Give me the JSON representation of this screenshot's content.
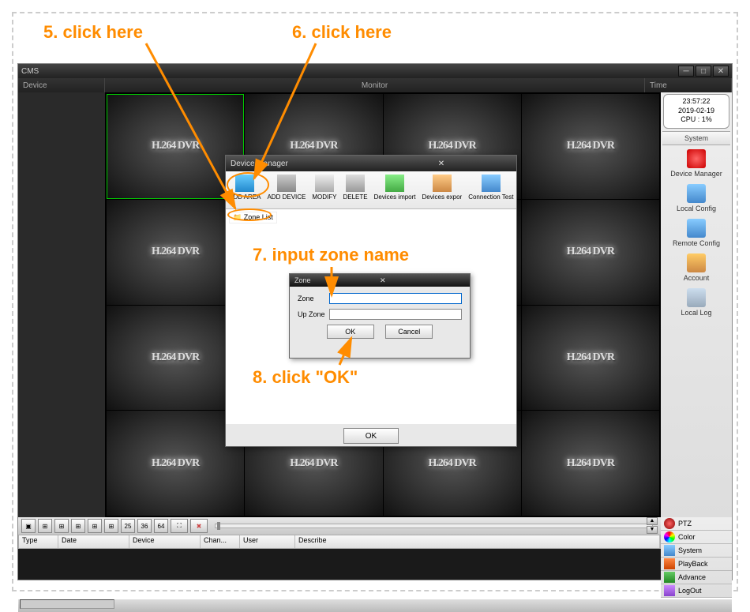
{
  "annotations": {
    "a5": "5. click here",
    "a6": "6. click here",
    "a7": "7. input zone name",
    "a8": "8. click \"OK\""
  },
  "app": {
    "title": "CMS",
    "header": {
      "device": "Device",
      "monitor": "Monitor",
      "time": "Time"
    },
    "clock": {
      "time": "23:57:22",
      "date": "2019-02-19",
      "cpu": "CPU : 1%"
    },
    "system_header": "System",
    "sys_items": [
      "Device Manager",
      "Local Config",
      "Remote Config",
      "Account",
      "Local Log"
    ],
    "cell_text": "H.264 DVR",
    "toolbar_nums": [
      "25",
      "36",
      "64"
    ],
    "log_cols": [
      "Type",
      "Date",
      "Device",
      "Chan...",
      "User",
      "Describe"
    ],
    "right_btns": [
      "PTZ",
      "Color",
      "System",
      "PlayBack",
      "Advance",
      "LogOut"
    ]
  },
  "dlg": {
    "title": "Device Manager",
    "btns": [
      "ADD AREA",
      "ADD DEVICE",
      "MODIFY",
      "DELETE",
      "Devices import",
      "Devices expor",
      "Connection Test"
    ],
    "zone_list": "Zone List",
    "ok": "OK"
  },
  "zone": {
    "title": "Zone",
    "zone_label": "Zone",
    "up_zone_label": "Up Zone",
    "ok": "OK",
    "cancel": "Cancel"
  }
}
